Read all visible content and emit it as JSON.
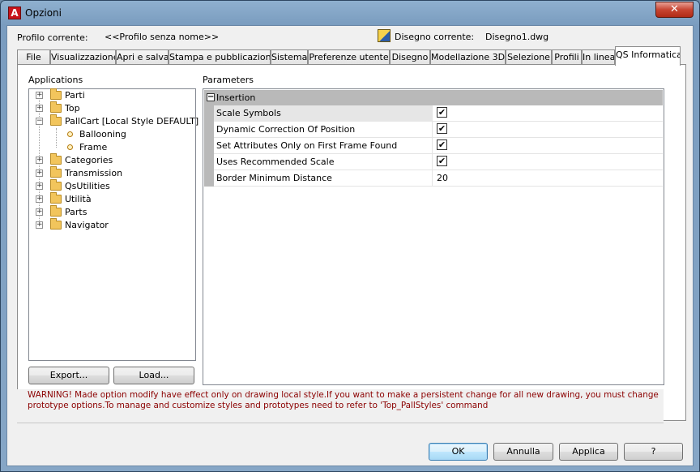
{
  "window": {
    "title": "Opzioni",
    "close_label": "✕",
    "app_icon_letter": "A"
  },
  "profile": {
    "label": "Profilo corrente:",
    "value": "<<Profilo senza nome>>"
  },
  "drawing": {
    "label": "Disegno corrente:",
    "value": "Disegno1.dwg"
  },
  "tabs": [
    {
      "label": "File"
    },
    {
      "label": "Visualizzazione"
    },
    {
      "label": "Apri e salva"
    },
    {
      "label": "Stampa e pubblicazione"
    },
    {
      "label": "Sistema"
    },
    {
      "label": "Preferenze utente"
    },
    {
      "label": "Disegno"
    },
    {
      "label": "Modellazione 3D"
    },
    {
      "label": "Selezione"
    },
    {
      "label": "Profili"
    },
    {
      "label": "In linea"
    },
    {
      "label": "QS Informatica"
    }
  ],
  "active_tab": "QS Informatica",
  "applications": {
    "label": "Applications",
    "tree": [
      {
        "label": "Parti",
        "expander": "+"
      },
      {
        "label": "Top",
        "expander": "+"
      },
      {
        "label": "PallCart [Local Style DEFAULT]",
        "expander": "−",
        "children": [
          "Ballooning",
          "Frame"
        ]
      },
      {
        "label": "Categories",
        "expander": "+"
      },
      {
        "label": "Transmission",
        "expander": "+"
      },
      {
        "label": "QsUtilities",
        "expander": "+"
      },
      {
        "label": "Utilità",
        "expander": "+"
      },
      {
        "label": "Parts",
        "expander": "+"
      },
      {
        "label": "Navigator",
        "expander": "+"
      }
    ],
    "export_label": "Export...",
    "load_label": "Load..."
  },
  "parameters": {
    "label": "Parameters",
    "group": {
      "title": "Insertion",
      "collapse_symbol": "−"
    },
    "rows": [
      {
        "name": "Scale Symbols",
        "type": "checkbox",
        "checked": true
      },
      {
        "name": "Dynamic Correction Of Position",
        "type": "checkbox",
        "checked": true
      },
      {
        "name": "Set Attributes Only on First Frame Found",
        "type": "checkbox",
        "checked": true
      },
      {
        "name": "Uses Recommended Scale",
        "type": "checkbox",
        "checked": true
      },
      {
        "name": "Border Minimum Distance",
        "type": "text",
        "value": "20"
      }
    ],
    "check_mark": "✔"
  },
  "warning": "WARNING! Made option modify have effect only on drawing local style.If you want to make a persistent change for all new drawing, you must change prototype options.To manage and customize styles and prototypes need to refer to 'Top_PallStyles' command",
  "footer": {
    "ok_label": "OK",
    "cancel_label": "Annulla",
    "apply_label": "Applica",
    "help_label": "?"
  }
}
